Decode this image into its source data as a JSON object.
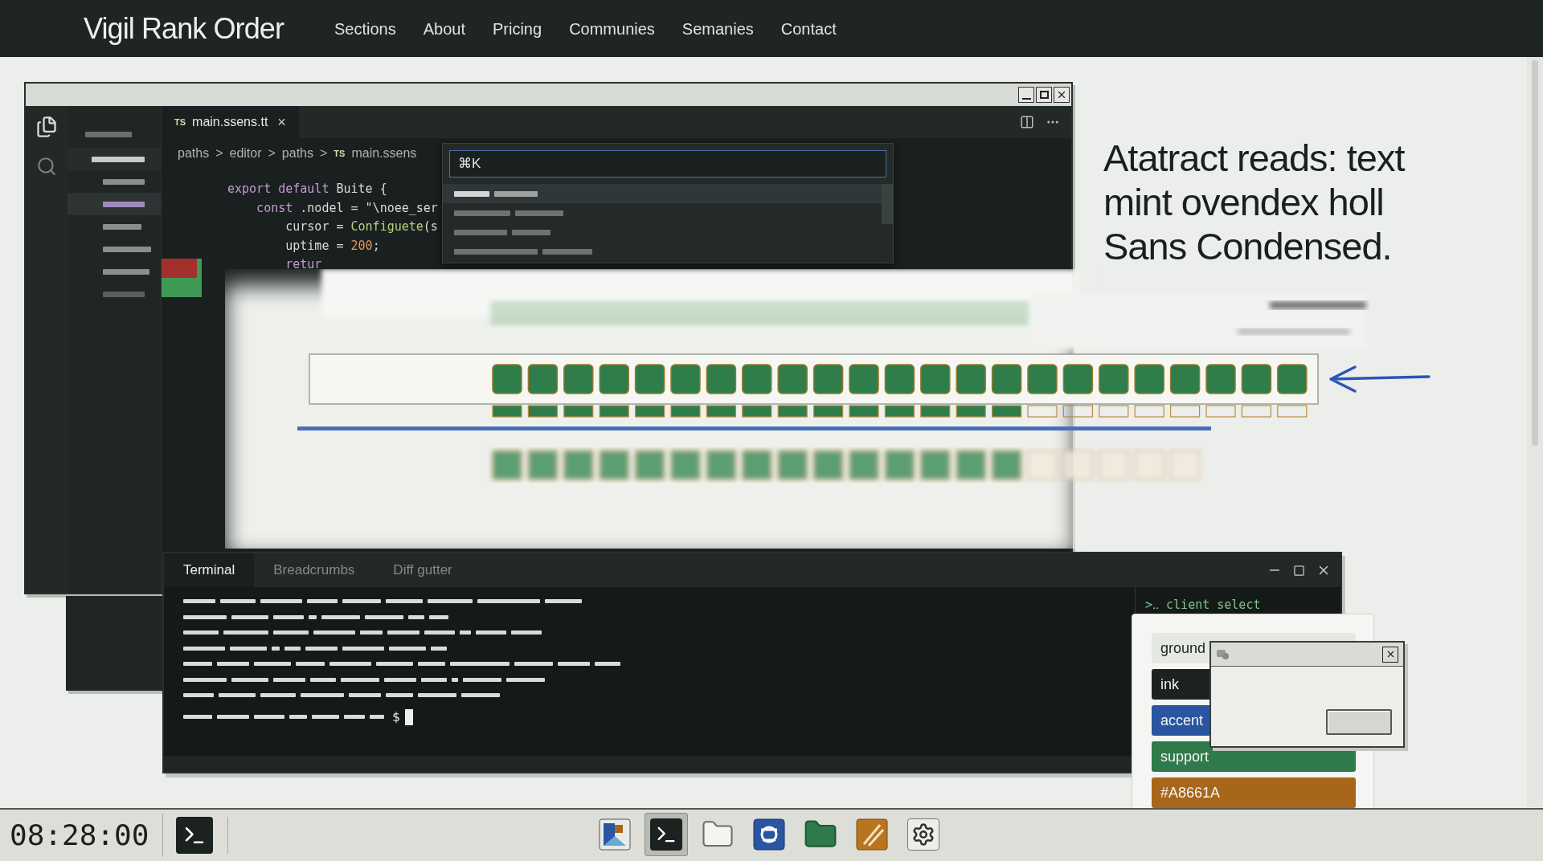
{
  "nav": {
    "title": "Vigil Rank Order",
    "links": [
      "Sections",
      "About",
      "Pricing",
      "Communies",
      "Semanies",
      "Contact"
    ]
  },
  "editor": {
    "tab": {
      "badge": "TS",
      "label": "main.ssens.tt",
      "close": "×"
    },
    "breadcrumbs": [
      {
        "label": "paths"
      },
      {
        "sep": ">",
        "label": "editor"
      },
      {
        "sep": ">",
        "label": "paths"
      },
      {
        "sep": ">",
        "badge": "TS",
        "label": "main.ssens"
      }
    ],
    "palette": {
      "value": "⌘K"
    },
    "code": [
      [
        {
          "kind": "keyword",
          "text": "export default"
        },
        {
          "kind": "plain",
          "text": " Buite {"
        }
      ],
      [
        {
          "kind": "keyword",
          "text": "    const"
        },
        {
          "kind": "plain",
          "text": " .nodel = "
        },
        {
          "kind": "string",
          "text": "\"\\noee_ser"
        }
      ],
      [
        {
          "kind": "plain",
          "text": "        cursor = "
        },
        {
          "kind": "func",
          "text": "Configuete"
        },
        {
          "kind": "plain",
          "text": "(s"
        }
      ],
      [
        {
          "kind": "plain",
          "text": "        uptime = "
        },
        {
          "kind": "number",
          "text": "200"
        },
        {
          "kind": "plain",
          "text": ";"
        }
      ],
      [
        {
          "kind": "keyword",
          "text": "        retur"
        }
      ]
    ]
  },
  "headline": "Atatract reads: text mint ovendex holl Sans Condensed.",
  "terminal": {
    "tabs": [
      {
        "label": "Terminal",
        "selected": true
      },
      {
        "label": "Breadcrumbs",
        "selected": false
      },
      {
        "label": "Diff gutter",
        "selected": false
      }
    ],
    "prompt": "$",
    "side": ">‥ client select"
  },
  "swatches": [
    {
      "label": "ground",
      "color": "#e6e8e4"
    },
    {
      "label": "ink",
      "color": "#1c2220"
    },
    {
      "label": "accent",
      "color": "#2a55a0"
    },
    {
      "label": "support",
      "color": "#2f7a4a"
    },
    {
      "label": "#A8661A",
      "color": "#a8661a"
    }
  ],
  "taskbar": {
    "clock": "08:28:00",
    "apps": [
      {
        "kind": "image",
        "selected": false
      },
      {
        "kind": "terminal",
        "selected": true
      },
      {
        "kind": "folder",
        "selected": false
      },
      {
        "kind": "blue",
        "selected": false
      },
      {
        "kind": "greenfolder",
        "selected": false
      },
      {
        "kind": "pen",
        "selected": false
      },
      {
        "kind": "gear",
        "selected": false
      }
    ]
  }
}
